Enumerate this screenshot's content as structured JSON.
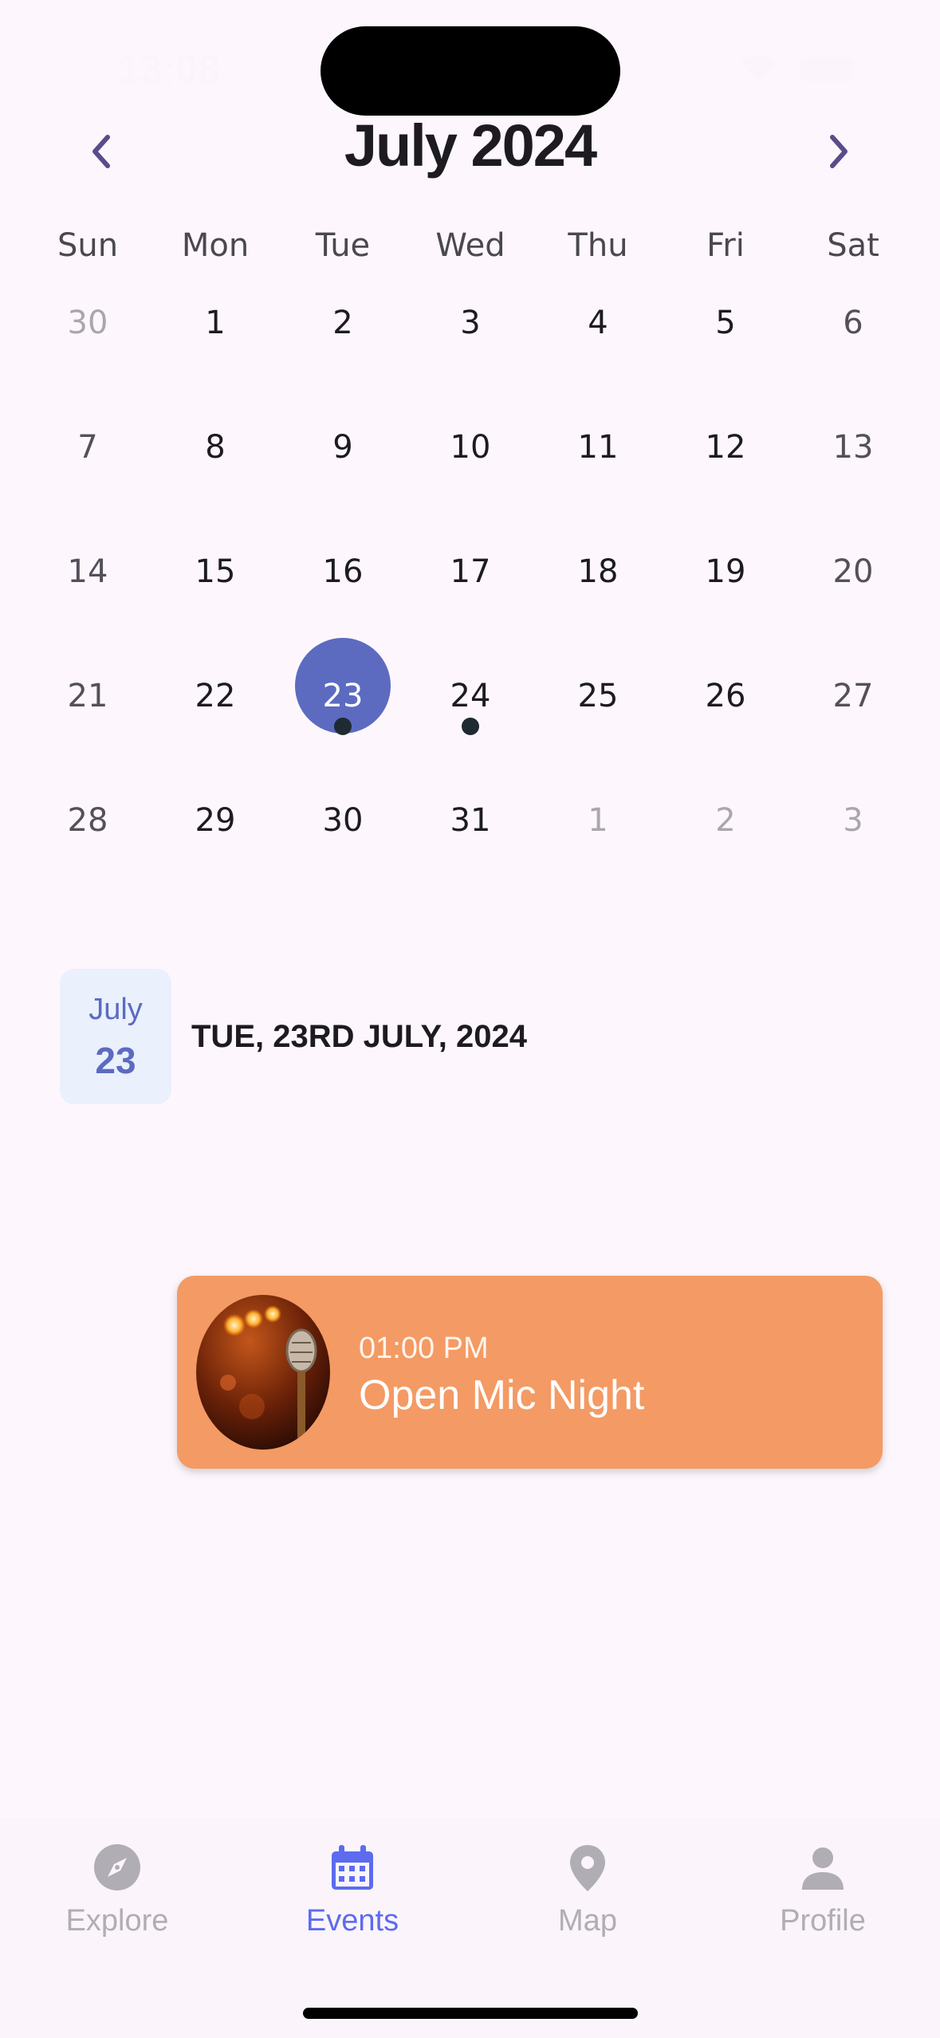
{
  "status_bar": {
    "time": "13:08"
  },
  "calendar": {
    "title": "July 2024",
    "weekdays": [
      "Sun",
      "Mon",
      "Tue",
      "Wed",
      "Thu",
      "Fri",
      "Sat"
    ],
    "weeks": [
      [
        "30",
        "1",
        "2",
        "3",
        "4",
        "5",
        "6"
      ],
      [
        "7",
        "8",
        "9",
        "10",
        "11",
        "12",
        "13"
      ],
      [
        "14",
        "15",
        "16",
        "17",
        "18",
        "19",
        "20"
      ],
      [
        "21",
        "22",
        "23",
        "24",
        "25",
        "26",
        "27"
      ],
      [
        "28",
        "29",
        "30",
        "31",
        "1",
        "2",
        "3"
      ]
    ],
    "selected_day": "23",
    "days_with_events": [
      "23",
      "24"
    ]
  },
  "selected_date": {
    "badge_month": "July",
    "badge_day": "23",
    "heading": "TUE, 23RD JULY, 2024"
  },
  "events": [
    {
      "time": "01:00 PM",
      "title": "Open Mic Night",
      "thumbnail": "microphone-stage-photo"
    }
  ],
  "bottom_nav": {
    "items": [
      {
        "label": "Explore",
        "icon": "compass-icon",
        "active": false
      },
      {
        "label": "Events",
        "icon": "calendar-icon",
        "active": true
      },
      {
        "label": "Map",
        "icon": "map-pin-icon",
        "active": false
      },
      {
        "label": "Profile",
        "icon": "person-icon",
        "active": false
      }
    ]
  },
  "colors": {
    "accent": "#5c6bc0",
    "event_card": "#f49a64",
    "background": "#fdf7fd",
    "badge_bg": "#eaf0fc"
  }
}
